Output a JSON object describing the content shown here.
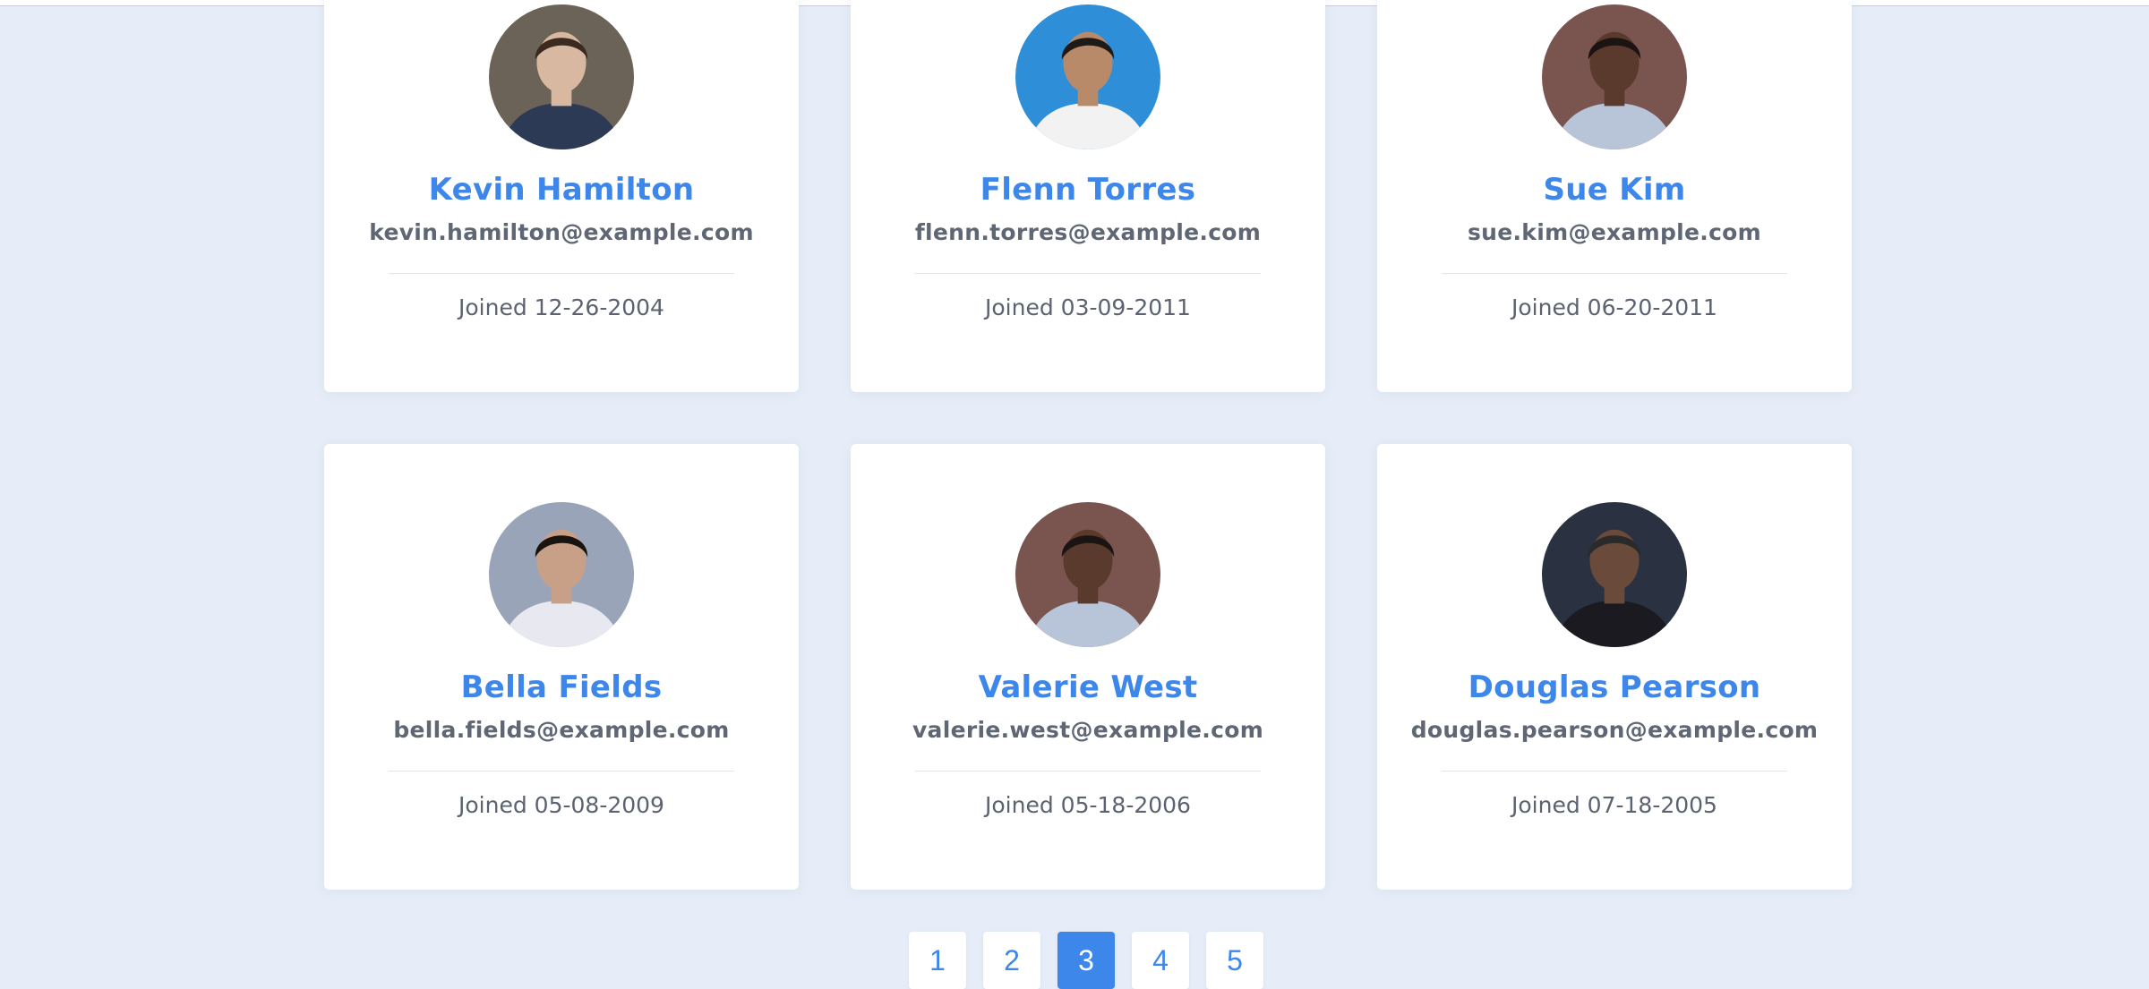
{
  "users": [
    {
      "name": "Kevin Hamilton",
      "email": "kevin.hamilton@example.com",
      "joined": "Joined 12-26-2004",
      "avatar_colors": {
        "bg": "#6b6258",
        "skin": "#d8b8a0",
        "hair": "#3a2a20",
        "shirt": "#2c3a55"
      }
    },
    {
      "name": "Flenn Torres",
      "email": "flenn.torres@example.com",
      "joined": "Joined 03-09-2011",
      "avatar_colors": {
        "bg": "#2e8fd8",
        "skin": "#b98a6a",
        "hair": "#1d1a18",
        "shirt": "#f2f2f2"
      }
    },
    {
      "name": "Sue Kim",
      "email": "sue.kim@example.com",
      "joined": "Joined 06-20-2011",
      "avatar_colors": {
        "bg": "#7a5550",
        "skin": "#5a3a2c",
        "hair": "#1c1412",
        "shirt": "#b8c4d8"
      }
    },
    {
      "name": "Bella Fields",
      "email": "bella.fields@example.com",
      "joined": "Joined 05-08-2009",
      "avatar_colors": {
        "bg": "#9aa4b8",
        "skin": "#c8a088",
        "hair": "#1a1410",
        "shirt": "#e8e8f0"
      }
    },
    {
      "name": "Valerie West",
      "email": "valerie.west@example.com",
      "joined": "Joined 05-18-2006",
      "avatar_colors": {
        "bg": "#7a5550",
        "skin": "#5a3a2c",
        "hair": "#1c1412",
        "shirt": "#b8c4d8"
      }
    },
    {
      "name": "Douglas Pearson",
      "email": "douglas.pearson@example.com",
      "joined": "Joined 07-18-2005",
      "avatar_colors": {
        "bg": "#2a3242",
        "skin": "#6a4a3a",
        "hair": "#2a2a2a",
        "shirt": "#1a1a20"
      }
    }
  ],
  "pagination": {
    "pages": [
      "1",
      "2",
      "3",
      "4",
      "5"
    ],
    "current": "3"
  },
  "colors": {
    "accent": "#3d86ea",
    "background": "#e6edf8",
    "text_muted": "#5f6775"
  }
}
